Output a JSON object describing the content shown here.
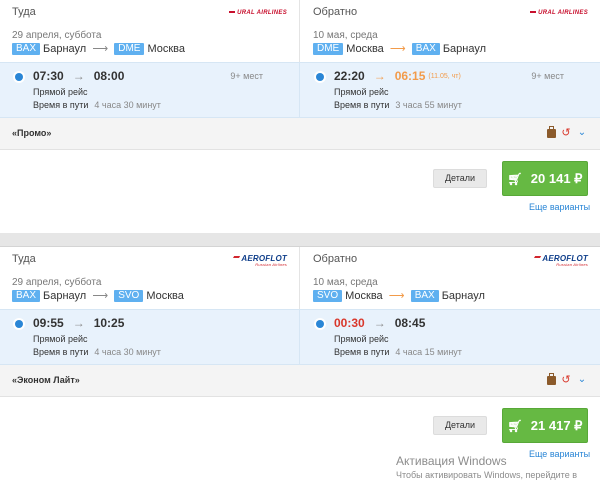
{
  "offers": [
    {
      "outbound": {
        "direction_label": "Туда",
        "airline_logo": "URAL AIRLINES",
        "date": "29 апреля",
        "weekday": "суббота",
        "from_code": "BAX",
        "from_city": "Барнаул",
        "to_code": "DME",
        "to_city": "Москва",
        "dep_time": "07:30",
        "arr_time": "08:00",
        "seats": "9+ мест",
        "direct_label": "Прямой рейс",
        "duration_label": "Время в пути",
        "duration": "4 часа 30 минут"
      },
      "return": {
        "direction_label": "Обратно",
        "airline_logo": "URAL AIRLINES",
        "date": "10 мая",
        "weekday": "среда",
        "from_code": "DME",
        "from_city": "Москва",
        "to_code": "BAX",
        "to_city": "Барнаул",
        "dep_time": "22:20",
        "arr_time": "06:15",
        "arr_note": "(11.05, чт)",
        "seats": "9+ мест",
        "direct_label": "Прямой рейс",
        "duration_label": "Время в пути",
        "duration": "3 часа 55 минут"
      },
      "tariff": "«Промо»",
      "details_label": "Детали",
      "price": "20 141 ₽",
      "more_label": "Еще варианты"
    },
    {
      "outbound": {
        "direction_label": "Туда",
        "airline_logo": "AEROFLOT",
        "airline_logo_sub": "Russian Airlines",
        "date": "29 апреля",
        "weekday": "суббота",
        "from_code": "BAX",
        "from_city": "Барнаул",
        "to_code": "SVO",
        "to_city": "Москва",
        "dep_time": "09:55",
        "arr_time": "10:25",
        "direct_label": "Прямой рейс",
        "duration_label": "Время в пути",
        "duration": "4 часа 30 минут"
      },
      "return": {
        "direction_label": "Обратно",
        "airline_logo": "AEROFLOT",
        "airline_logo_sub": "Russian Airlines",
        "date": "10 мая",
        "weekday": "среда",
        "from_code": "SVO",
        "from_city": "Москва",
        "to_code": "BAX",
        "to_city": "Барнаул",
        "dep_time": "00:30",
        "arr_time": "08:45",
        "direct_label": "Прямой рейс",
        "duration_label": "Время в пути",
        "duration": "4 часа 15 минут"
      },
      "tariff": "«Эконом Лайт»",
      "details_label": "Детали",
      "price": "21 417 ₽",
      "more_label": "Еще варианты"
    }
  ],
  "icons": {
    "cart": "shopping-cart-icon",
    "baggage": "baggage-icon",
    "no_refund": "no-refund-icon",
    "expand": "chevron-down-icon"
  },
  "colors": {
    "accent": "#2a86d6",
    "code_badge": "#5fb0f0",
    "buy_button": "#66b943",
    "overnight": "#f29b4a",
    "night_dep": "#d9372b"
  },
  "watermark": {
    "title": "Активация Windows",
    "subtitle": "Чтобы активировать Windows, перейдите в"
  }
}
